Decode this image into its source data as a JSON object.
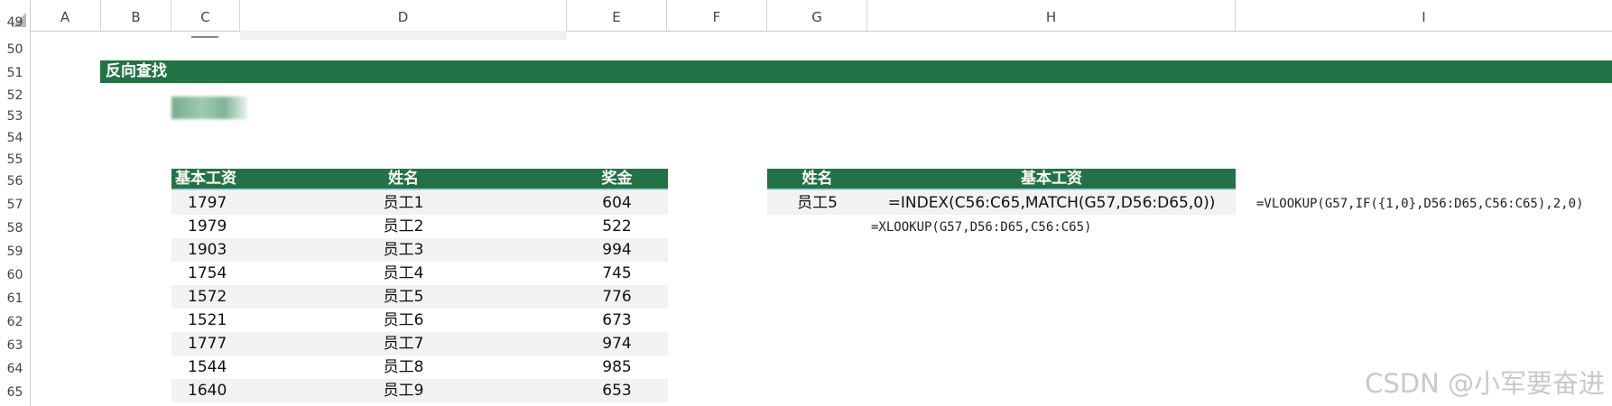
{
  "columns": [
    "A",
    "B",
    "C",
    "D",
    "E",
    "F",
    "G",
    "H",
    "I"
  ],
  "rows": [
    "49",
    "50",
    "51",
    "52",
    "53",
    "54",
    "55",
    "56",
    "57",
    "58",
    "59",
    "60",
    "61",
    "62",
    "63",
    "64",
    "65"
  ],
  "section_title": "反向查找",
  "main_table": {
    "headers": [
      "基本工资",
      "姓名",
      "奖金"
    ],
    "rows": [
      {
        "salary": "1797",
        "name": "员工1",
        "bonus": "604"
      },
      {
        "salary": "1979",
        "name": "员工2",
        "bonus": "522"
      },
      {
        "salary": "1903",
        "name": "员工3",
        "bonus": "994"
      },
      {
        "salary": "1754",
        "name": "员工4",
        "bonus": "745"
      },
      {
        "salary": "1572",
        "name": "员工5",
        "bonus": "776"
      },
      {
        "salary": "1521",
        "name": "员工6",
        "bonus": "673"
      },
      {
        "salary": "1777",
        "name": "员工7",
        "bonus": "974"
      },
      {
        "salary": "1544",
        "name": "员工8",
        "bonus": "985"
      },
      {
        "salary": "1640",
        "name": "员工9",
        "bonus": "653"
      }
    ]
  },
  "lookup_table": {
    "headers": [
      "姓名",
      "基本工资"
    ],
    "name": "员工5",
    "index_formula": "=INDEX(C56:C65,MATCH(G57,D56:D65,0))"
  },
  "formulas": {
    "vlookup": "=VLOOKUP(G57,IF({1,0},D56:D65,C56:C65),2,0)",
    "xlookup": "=XLOOKUP(G57,D56:D65,C56:C65)"
  },
  "watermark": "CSDN @小军要奋进",
  "colors": {
    "header_green": "#217346",
    "row_shade": "#f2f2f2"
  }
}
